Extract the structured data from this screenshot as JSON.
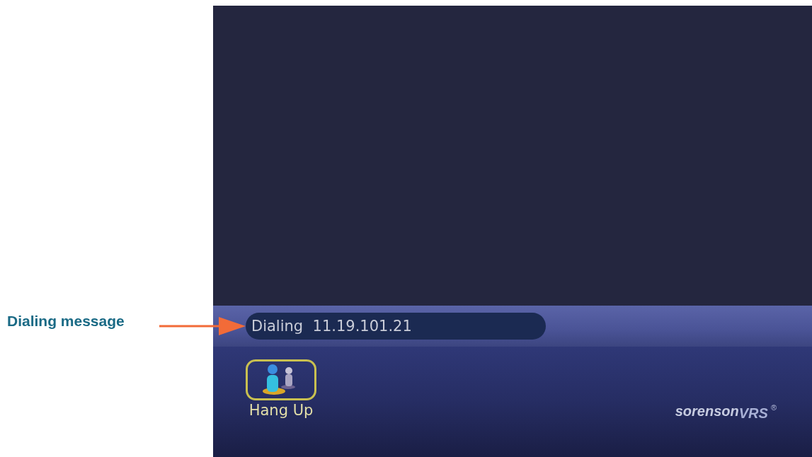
{
  "callout": {
    "label": "Dialing message"
  },
  "screen": {
    "status_message": "Dialing  11.19.101.21",
    "buttons": [
      {
        "label": "Hang Up",
        "kind": "hangup",
        "selected": true
      }
    ],
    "logo": {
      "brand": "sorenson",
      "product": "VRS",
      "mark": "®"
    }
  }
}
